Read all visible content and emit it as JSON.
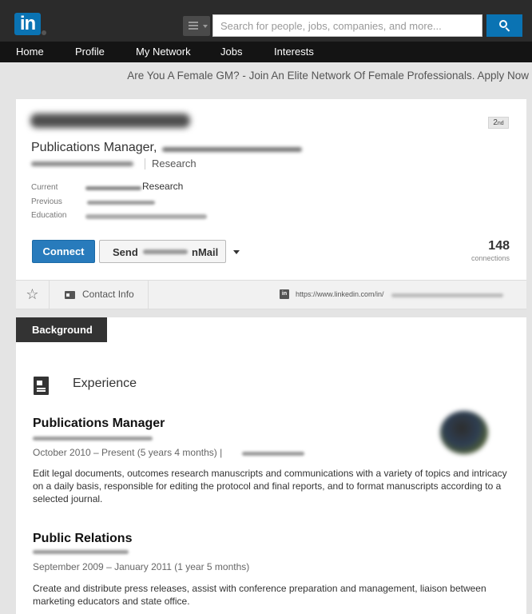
{
  "search": {
    "placeholder": "Search for people, jobs, companies, and more..."
  },
  "nav": {
    "items": [
      "Home",
      "Profile",
      "My Network",
      "Jobs",
      "Interests"
    ]
  },
  "ad": {
    "text": "Are You A Female GM? - Join An Elite Network Of Female Professionals. Apply Now"
  },
  "profile": {
    "degree": "2",
    "degree_suffix": "nd",
    "headline": "Publications Manager,",
    "industry": "Research",
    "labels": {
      "current": "Current",
      "previous": "Previous",
      "education": "Education"
    },
    "current_value": "Research",
    "connect_label": "Connect",
    "inmail_prefix": "Send",
    "inmail_suffix": "nMail",
    "connections_count": "148",
    "connections_label": "connections"
  },
  "contact": {
    "label": "Contact Info",
    "in_badge": "in",
    "public_url": "https://www.linkedin.com/in/"
  },
  "background": {
    "tab_label": "Background",
    "section_heading": "Experience",
    "jobs": [
      {
        "title": "Publications Manager",
        "dates": "October 2010 – Present (5 years 4 months) |",
        "description": "Edit legal documents, outcomes research manuscripts and communications with a variety of topics and intricacy on a daily basis, responsible for editing the protocol and final reports, and to format manuscripts according to a selected journal."
      },
      {
        "title": "Public Relations",
        "dates": "September 2009 – January 2011 (1 year 5 months)",
        "description": "Create and distribute press releases, assist with conference preparation and management, liaison between marketing educators and state office."
      }
    ]
  },
  "colors": {
    "brand": "#0a73b3",
    "topbar": "#2b2b2b",
    "navbar": "#141414",
    "connect_button": "#287bbc"
  },
  "icons": {
    "logo": "linkedin-logo",
    "search": "search-icon",
    "star": "star-icon",
    "contact": "contact-card-icon",
    "experience": "document-icon"
  }
}
